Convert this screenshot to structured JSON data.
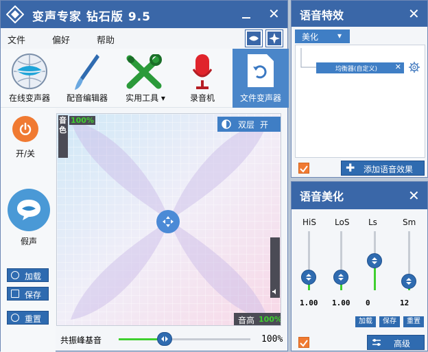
{
  "app": {
    "title": "变声专家  钻石版  9.5",
    "menu": [
      "文件",
      "偏好",
      "帮助"
    ]
  },
  "toolbar": {
    "items": [
      {
        "label": "在线变声器",
        "icon": "lips-globe-icon"
      },
      {
        "label": "配音编辑器",
        "icon": "paintbrush-icon"
      },
      {
        "label": "实用工具",
        "icon": "tools-icon"
      },
      {
        "label": "录音机",
        "icon": "microphone-icon"
      },
      {
        "label": "文件变声器",
        "icon": "file-refresh-icon"
      }
    ]
  },
  "side": {
    "power_label": "开/关",
    "falsetto_label": "假声",
    "buttons": {
      "load": "加载",
      "save": "保存",
      "reset": "重置"
    }
  },
  "pad": {
    "timbre_label": "音色",
    "timbre_value": "100%",
    "pitch_label": "音高",
    "pitch_value": "100%",
    "dual_label": "双层",
    "dual_state": "开"
  },
  "resonance": {
    "label": "共振峰基音",
    "value": "100%",
    "level": 0.35
  },
  "effects_panel": {
    "title": "语音特效",
    "dropdown_value": "美化",
    "chip_label": "均衡器(自定义)",
    "add_button": "添加语音效果"
  },
  "beautify_panel": {
    "title": "语音美化",
    "bands": [
      {
        "label": "HiS",
        "value": "1.00",
        "level": 0.22
      },
      {
        "label": "LoS",
        "value": "1.00",
        "level": 0.22
      },
      {
        "label": "Ls",
        "value": "0",
        "level": 0.5
      },
      {
        "label": "Sm",
        "value": "12",
        "level": 0.15
      }
    ],
    "mini_buttons": [
      "加载",
      "保存",
      "重置"
    ],
    "advanced_button": "高级"
  },
  "colors": {
    "titlebar": "#3a67a8",
    "accent": "#2f6bb0",
    "power": "#f07a32",
    "meter_green": "#3fcf2f"
  }
}
